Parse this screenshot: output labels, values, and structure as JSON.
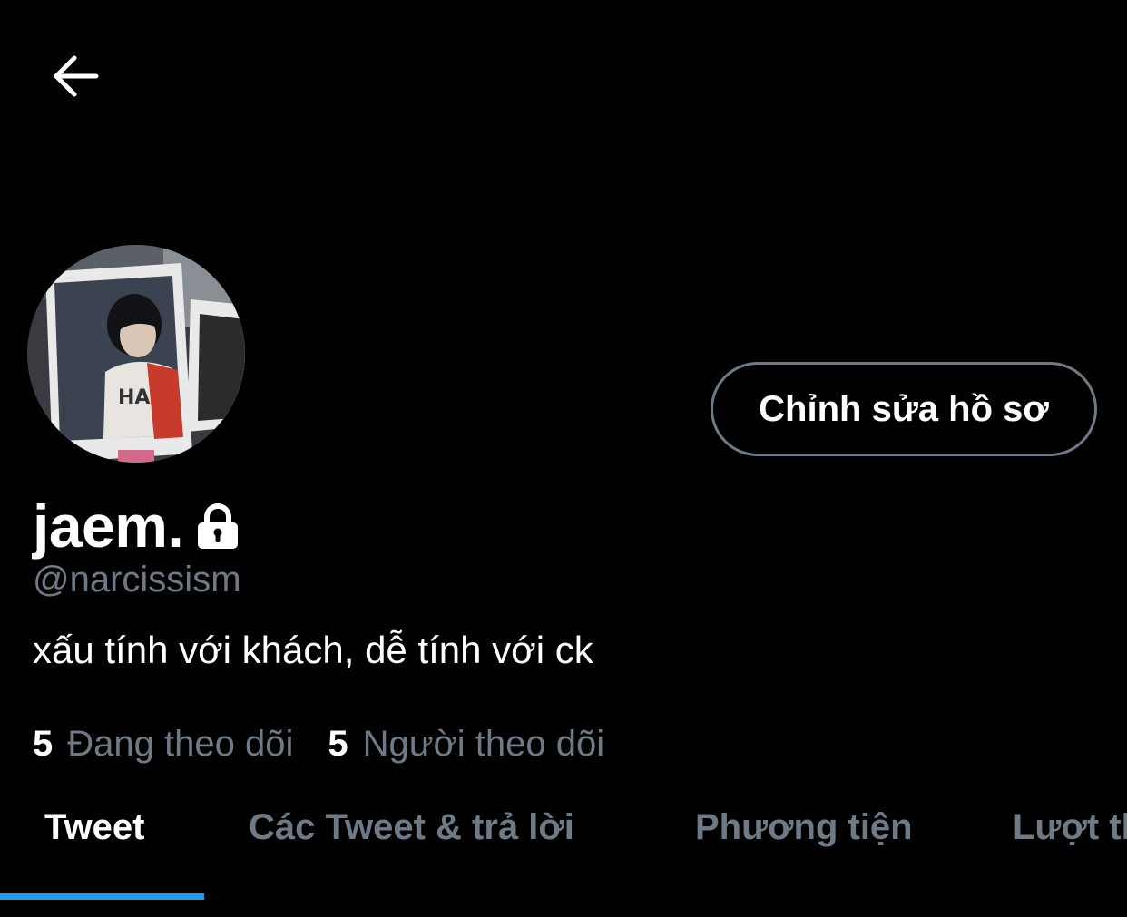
{
  "header": {
    "back_icon": "arrow-left-icon"
  },
  "profile": {
    "avatar": "profile-photo",
    "display_name": "jaem.",
    "protected_icon": "lock-icon",
    "handle": "@narcissism",
    "bio": "xấu tính với khách, dễ tính với ck",
    "edit_button_label": "Chỉnh sửa hồ sơ",
    "following_count": "5",
    "following_label": "Đang theo dõi",
    "followers_count": "5",
    "followers_label": "Người theo dõi"
  },
  "tabs": [
    {
      "label": "Tweet",
      "active": true
    },
    {
      "label": "Các Tweet & trả lời",
      "active": false
    },
    {
      "label": "Phương tiện",
      "active": false
    },
    {
      "label": "Lượt thích",
      "active": false
    }
  ],
  "colors": {
    "background": "#000000",
    "text_primary": "#ffffff",
    "text_secondary": "#6e7a86",
    "accent": "#1d9bf0"
  }
}
